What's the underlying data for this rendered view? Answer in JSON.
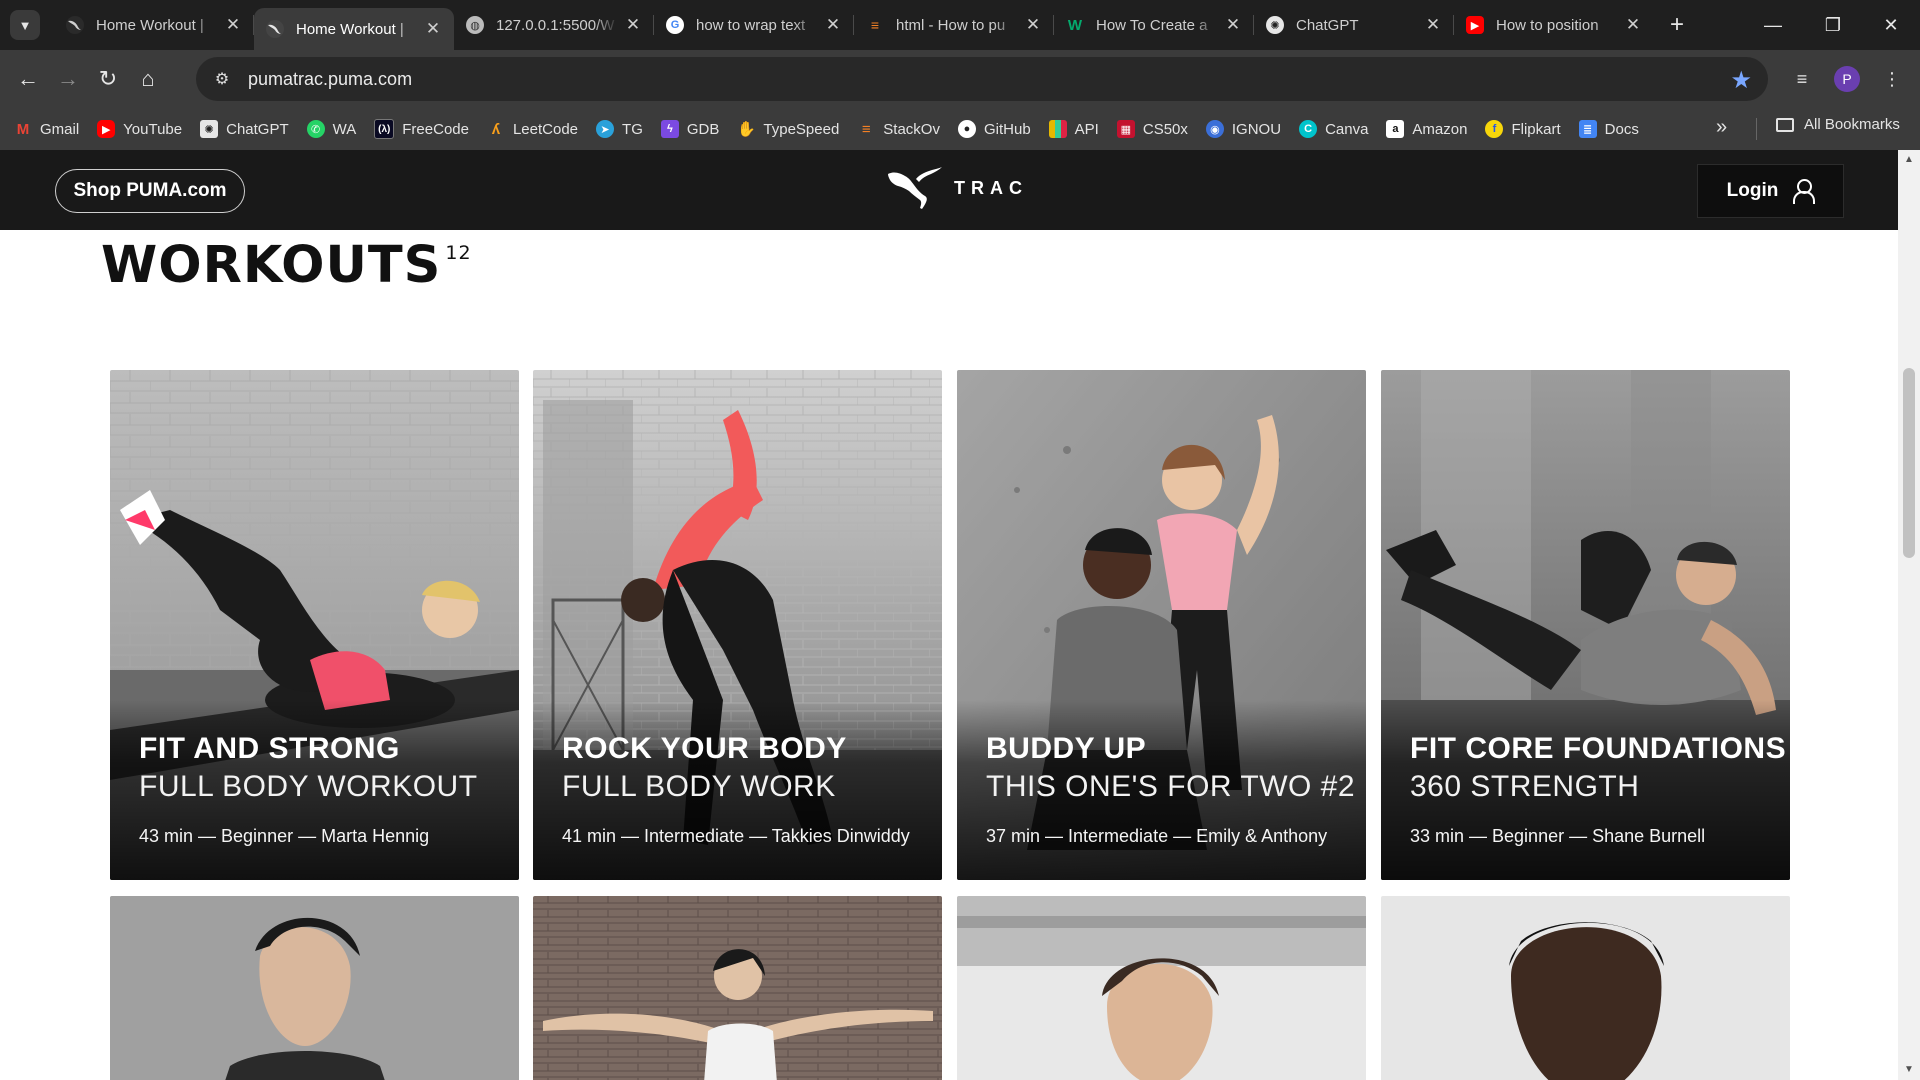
{
  "browser": {
    "tabs": [
      {
        "title": "Home Workout |",
        "favicon": "puma-icon",
        "active": false
      },
      {
        "title": "Home Workout |",
        "favicon": "puma-icon",
        "active": true
      },
      {
        "title": "127.0.0.1:5500/W",
        "favicon": "globe-icon",
        "active": false
      },
      {
        "title": "how to wrap text",
        "favicon": "google-icon",
        "active": false
      },
      {
        "title": "html - How to pu",
        "favicon": "stackoverflow-icon",
        "active": false
      },
      {
        "title": "How To Create a",
        "favicon": "w3schools-icon",
        "active": false
      },
      {
        "title": "ChatGPT",
        "favicon": "chatgpt-icon",
        "active": false
      },
      {
        "title": "How to position",
        "favicon": "youtube-icon",
        "active": false
      }
    ],
    "url": "pumatrac.puma.com",
    "profile_initial": "P",
    "bookmarks": [
      {
        "label": "Gmail",
        "icon": "gmail-icon",
        "color": "#ea4335"
      },
      {
        "label": "YouTube",
        "icon": "youtube-icon",
        "color": "#ff0000"
      },
      {
        "label": "ChatGPT",
        "icon": "chatgpt-icon",
        "color": "#5a5a5a"
      },
      {
        "label": "WA",
        "icon": "whatsapp-icon",
        "color": "#25d366"
      },
      {
        "label": "FreeCode",
        "icon": "freecodecamp-icon",
        "color": "#0a0a23"
      },
      {
        "label": "LeetCode",
        "icon": "leetcode-icon",
        "color": "#f89f1b"
      },
      {
        "label": "TG",
        "icon": "telegram-icon",
        "color": "#2aa1da"
      },
      {
        "label": "GDB",
        "icon": "gdb-icon",
        "color": "#7b4ae2"
      },
      {
        "label": "TypeSpeed",
        "icon": "typespeed-icon",
        "color": "#f08a24"
      },
      {
        "label": "StackOv",
        "icon": "stackoverflow-icon",
        "color": "#f48024"
      },
      {
        "label": "GitHub",
        "icon": "github-icon",
        "color": "#222222"
      },
      {
        "label": "API",
        "icon": "api-icon",
        "color": "#d9a400"
      },
      {
        "label": "CS50x",
        "icon": "cs50-icon",
        "color": "#c4122f"
      },
      {
        "label": "IGNOU",
        "icon": "ignou-icon",
        "color": "#3b6fd8"
      },
      {
        "label": "Canva",
        "icon": "canva-icon",
        "color": "#00c4cc"
      },
      {
        "label": "Amazon",
        "icon": "amazon-icon",
        "color": "#ffffff"
      },
      {
        "label": "Flipkart",
        "icon": "flipkart-icon",
        "color": "#f7d60b"
      },
      {
        "label": "Docs",
        "icon": "docs-icon",
        "color": "#4285f4"
      }
    ],
    "all_bookmarks_label": "All Bookmarks"
  },
  "site": {
    "shop_label": "Shop PUMA.com",
    "logo_text": "TRAC",
    "login_label": "Login"
  },
  "section": {
    "title": "WORKOUTS",
    "count": "12"
  },
  "workouts": [
    {
      "title": "FIT AND STRONG",
      "subtitle": "FULL BODY WORKOUT",
      "meta": "43 min — Beginner — Marta Hennig"
    },
    {
      "title": "ROCK YOUR BODY",
      "subtitle": "FULL BODY WORK",
      "meta": "41 min — Intermediate — Takkies Dinwiddy"
    },
    {
      "title": "BUDDY UP",
      "subtitle": "THIS ONE'S FOR TWO #2",
      "meta": "37 min — Intermediate — Emily & Anthony"
    },
    {
      "title": "FIT CORE FOUNDATIONS",
      "subtitle": "360 STRENGTH",
      "meta": "33 min — Beginner — Shane Burnell"
    }
  ],
  "colors": {
    "chrome_dark": "#1f1f1f",
    "chrome_mid": "#3b3b3b",
    "site_header": "#191919",
    "accent_star": "#7aa7ff"
  }
}
